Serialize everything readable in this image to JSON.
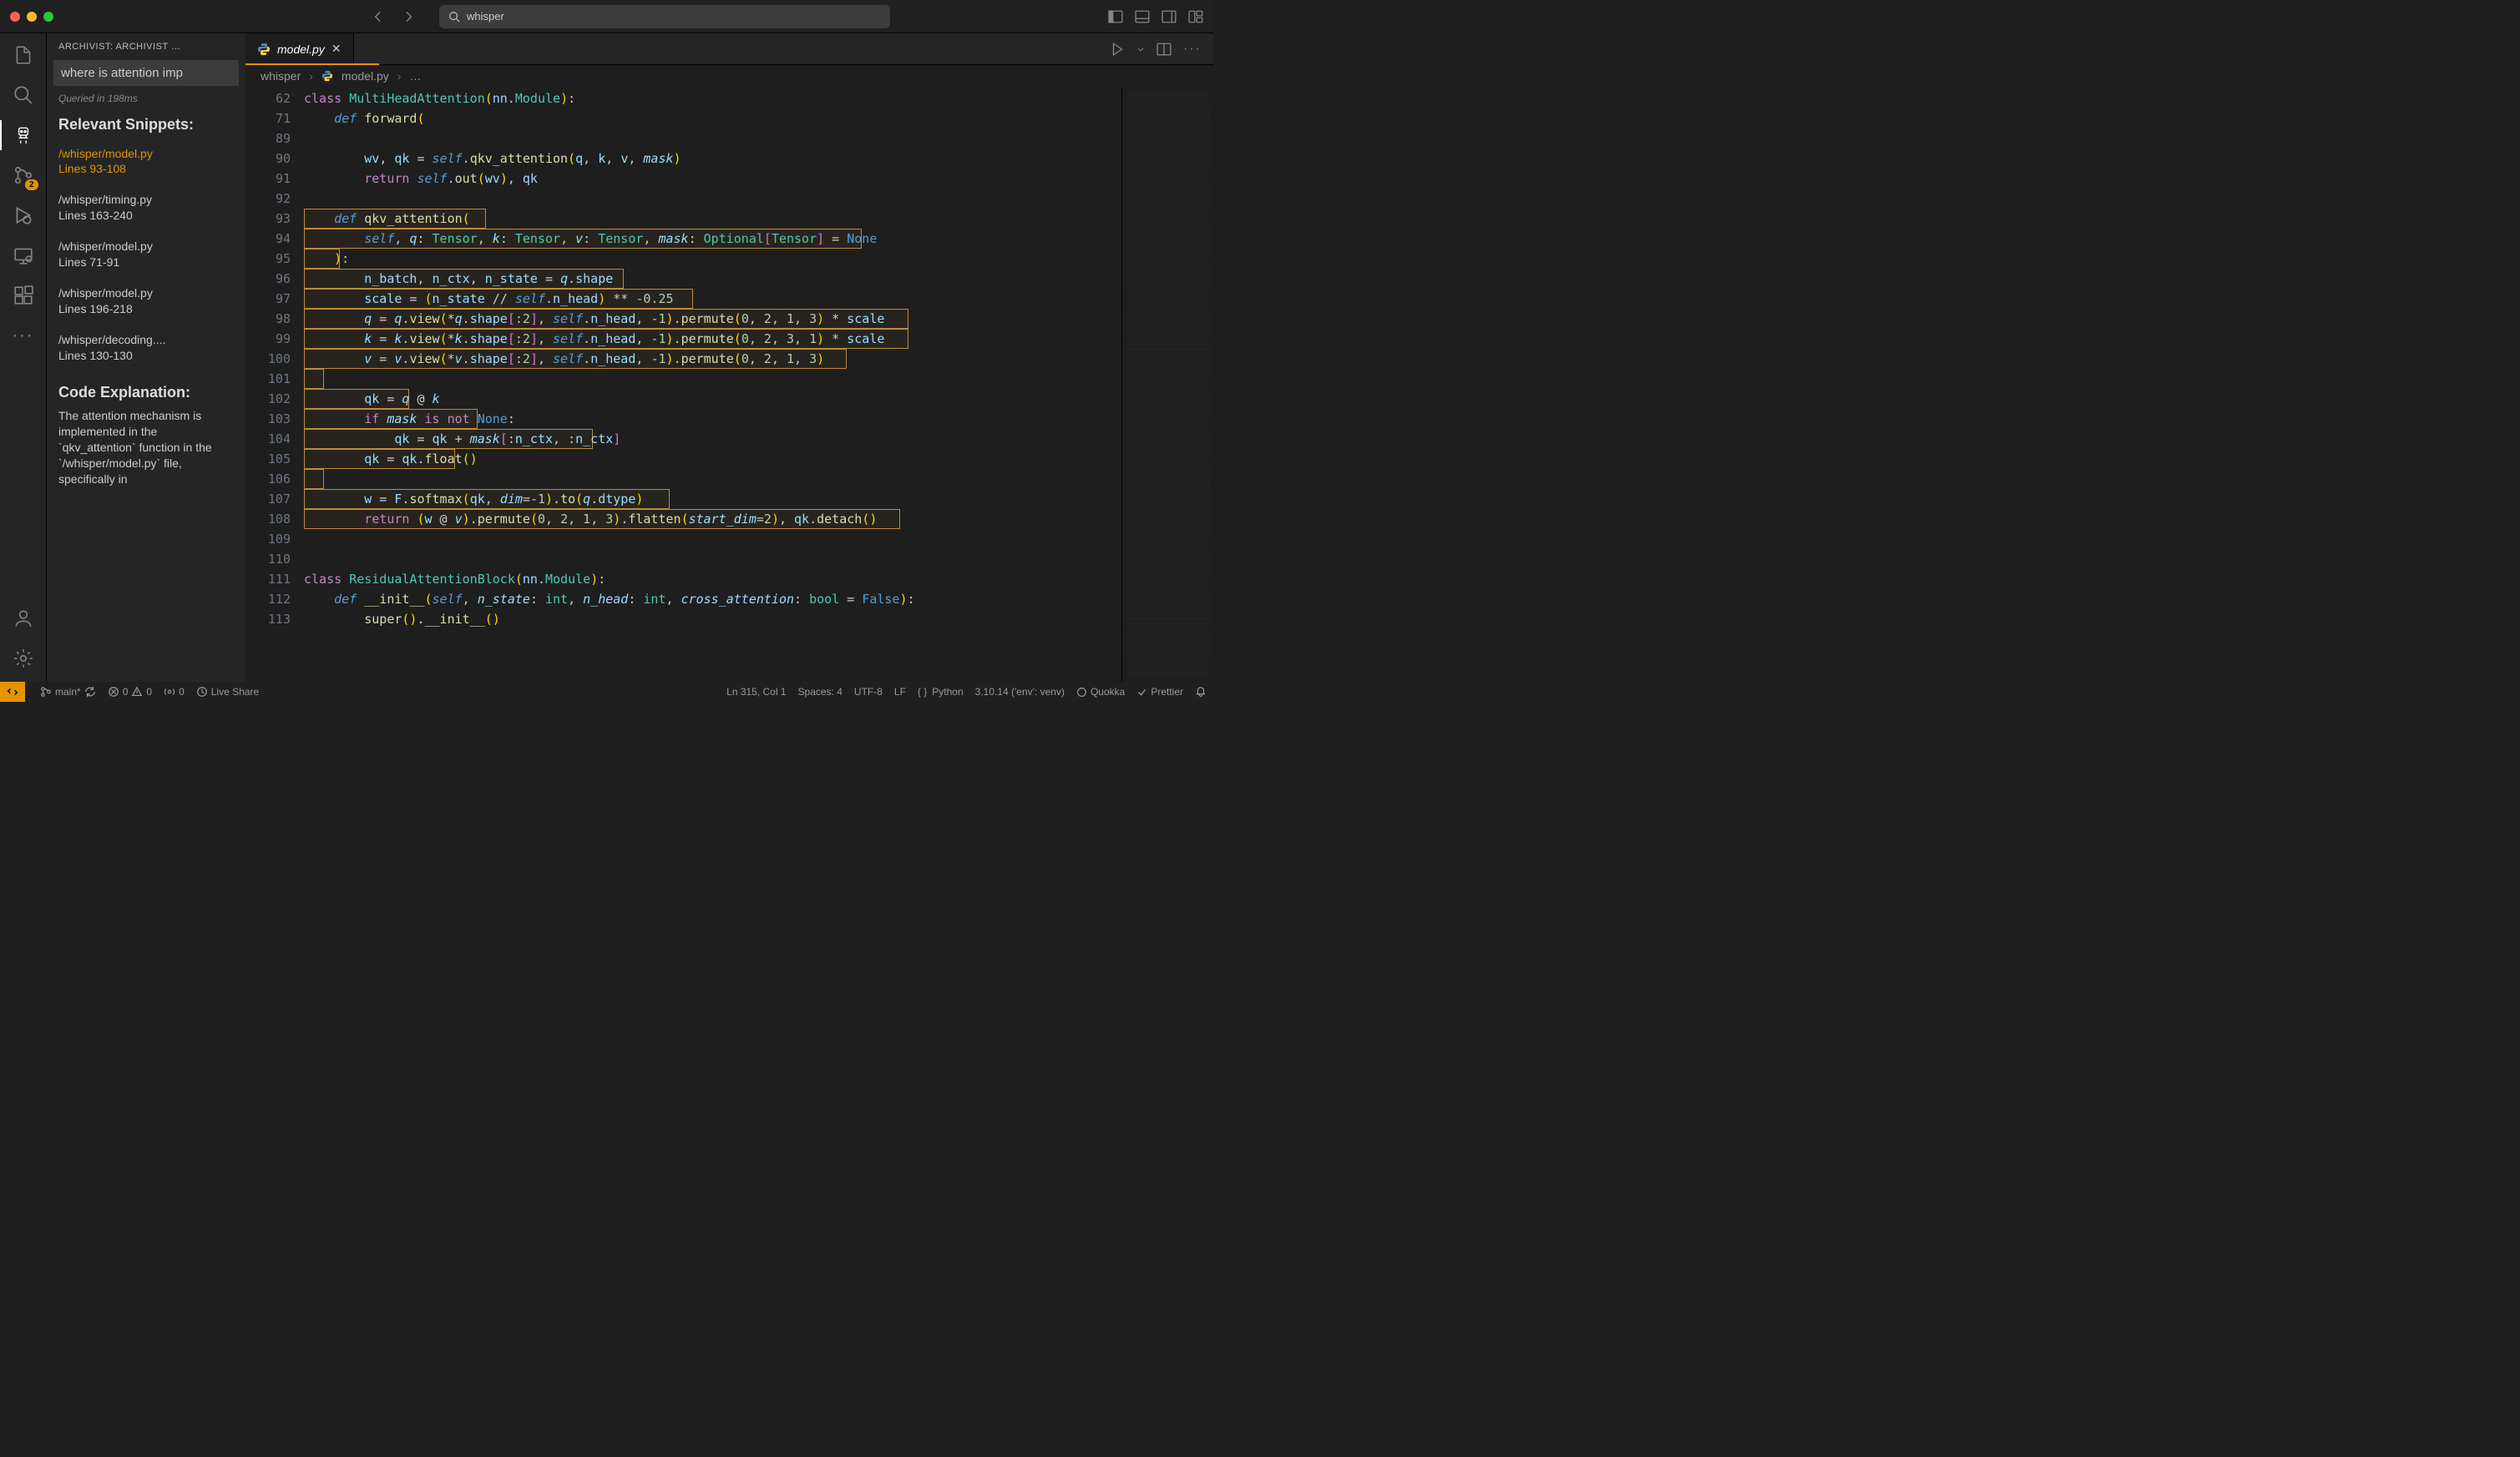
{
  "titlebar": {
    "search_text": "whisper"
  },
  "activity": {
    "scm_badge": "2"
  },
  "sidebar": {
    "title": "ARCHIVIST: ARCHIVIST …",
    "input_value": "where is attention imp",
    "queried": "Queried in 198ms",
    "section_title": "Relevant Snippets:",
    "snippets": [
      {
        "path": "/whisper/model.py",
        "lines": "Lines 93-108",
        "active": true
      },
      {
        "path": "/whisper/timing.py",
        "lines": "Lines 163-240",
        "active": false
      },
      {
        "path": "/whisper/model.py",
        "lines": "Lines 71-91",
        "active": false
      },
      {
        "path": "/whisper/model.py",
        "lines": "Lines 196-218",
        "active": false
      },
      {
        "path": "/whisper/decoding....",
        "lines": "Lines 130-130",
        "active": false
      }
    ],
    "explain_title": "Code Explanation:",
    "explain_body": "The attention mechanism is implemented in the `qkv_attention` function in the `/whisper/model.py` file, specifically in"
  },
  "tabs": {
    "open": [
      {
        "icon": "py",
        "label": "model.py",
        "dirty": false
      }
    ]
  },
  "breadcrumb": {
    "segments": [
      "whisper",
      "model.py",
      "…"
    ]
  },
  "editor": {
    "line_numbers": [
      "62",
      "71",
      "89",
      "90",
      "91",
      "92",
      "93",
      "94",
      "95",
      "96",
      "97",
      "98",
      "99",
      "100",
      "101",
      "102",
      "103",
      "104",
      "105",
      "106",
      "107",
      "108",
      "109",
      "110",
      "111",
      "112",
      "113"
    ],
    "highlighted_start": 6,
    "highlighted_end": 21
  },
  "statusbar": {
    "branch": "main*",
    "errors": "0",
    "warnings": "0",
    "ports": "0",
    "live_share": "Live Share",
    "position": "Ln 315, Col 1",
    "spaces": "Spaces: 4",
    "encoding": "UTF-8",
    "eol": "LF",
    "language": "Python",
    "interpreter": "3.10.14 ('env': venv)",
    "quokka": "Quokka",
    "prettier": "Prettier"
  }
}
